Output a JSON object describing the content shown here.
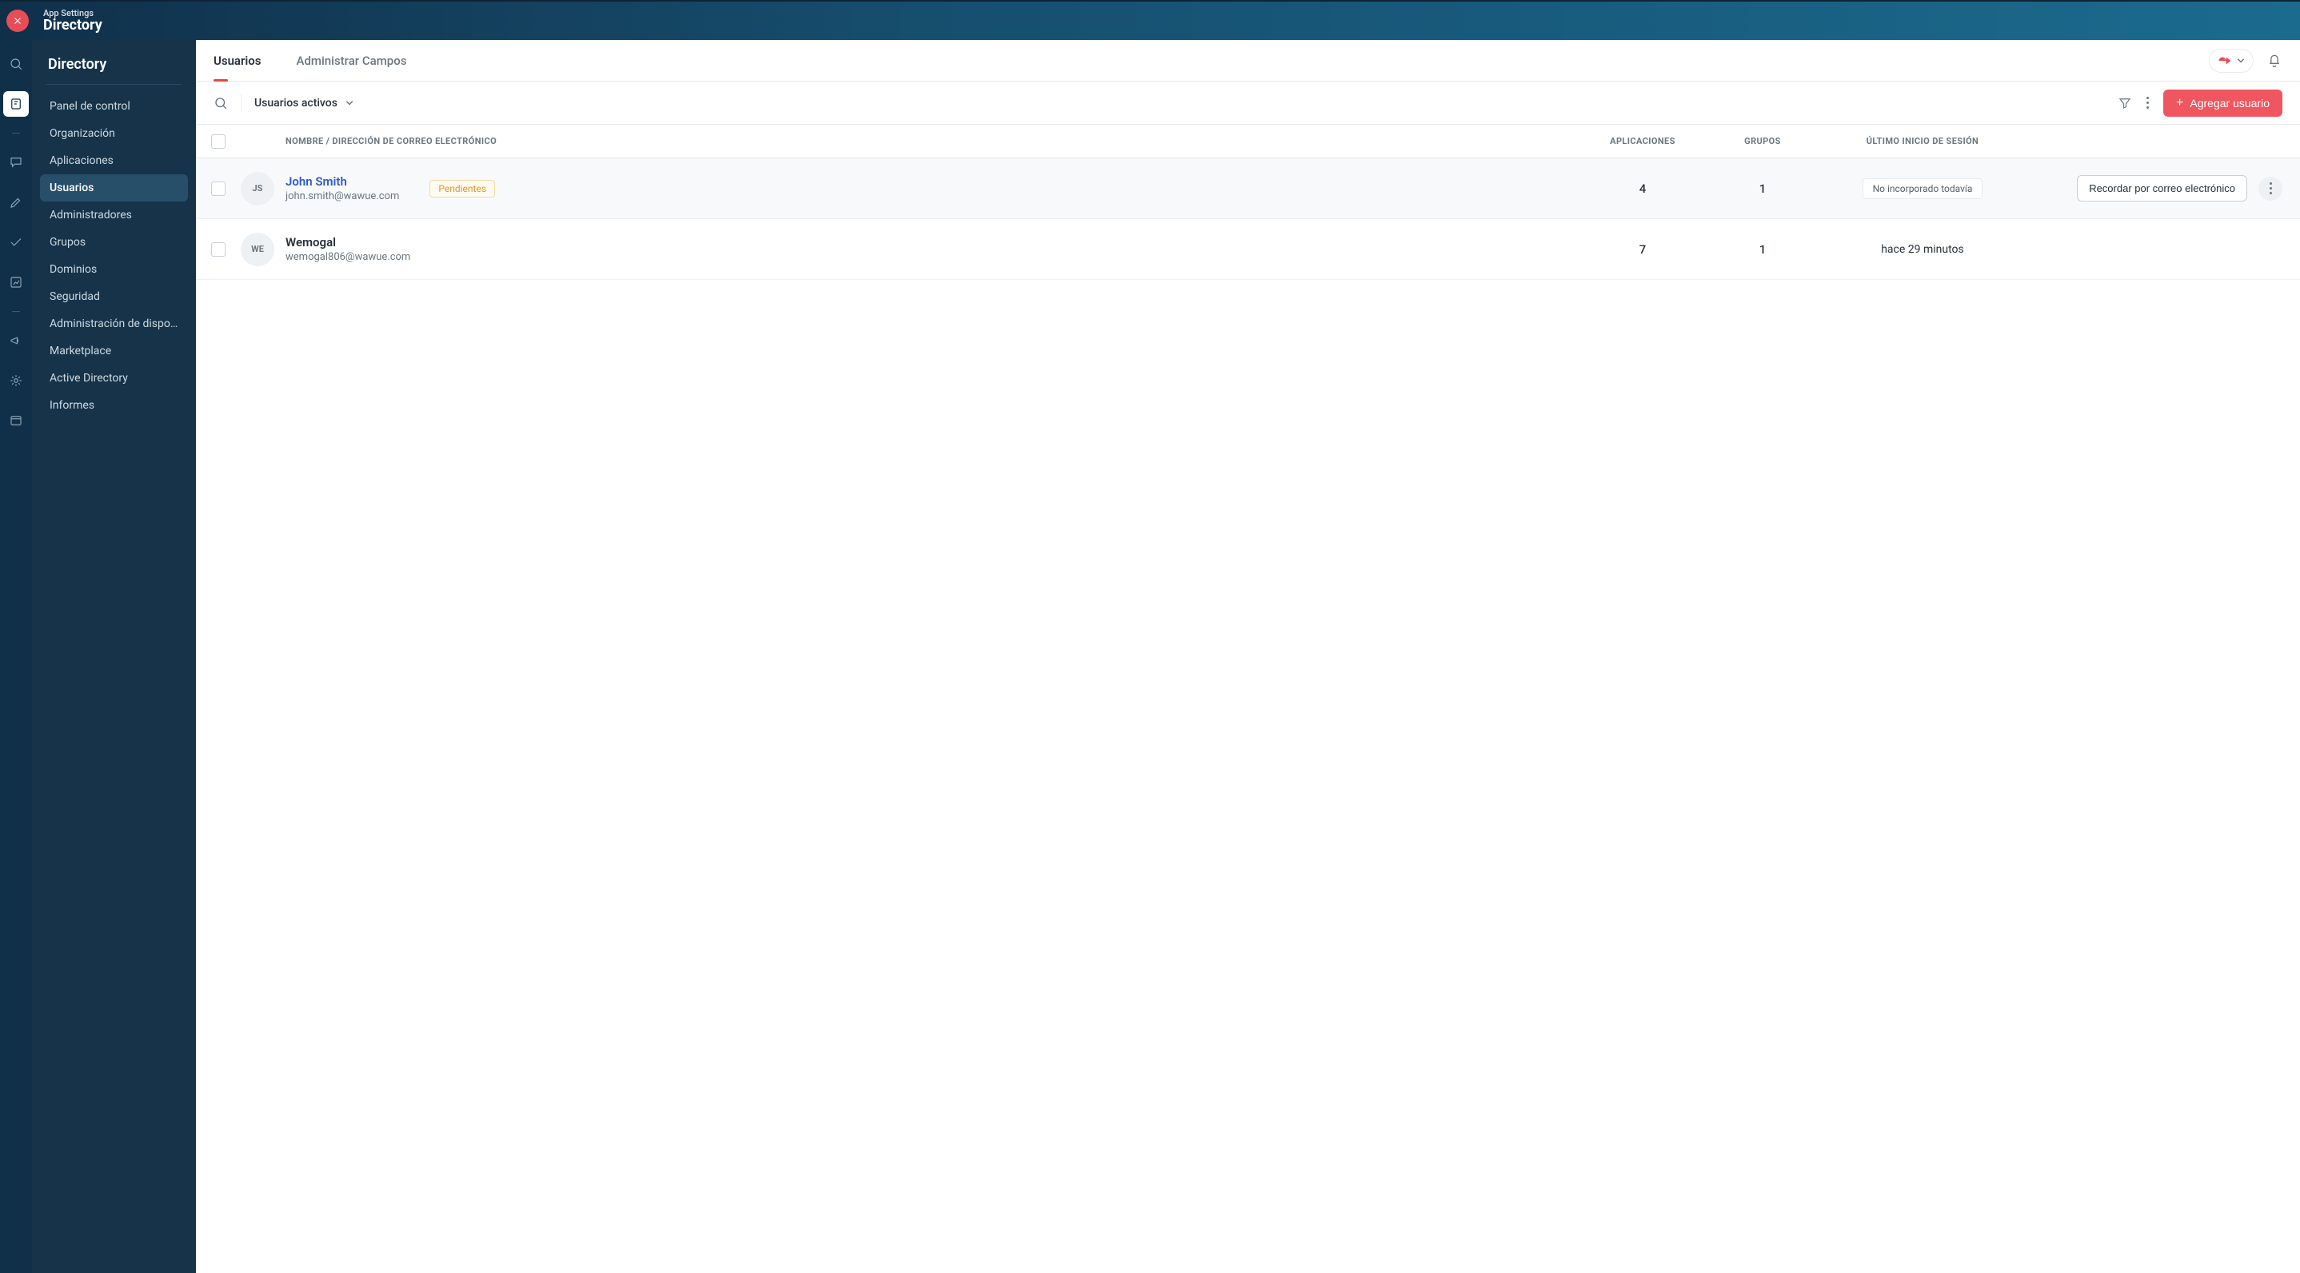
{
  "header": {
    "subtitle": "App Settings",
    "title": "Directory"
  },
  "sidebar": {
    "title": "Directory",
    "items": [
      {
        "label": "Panel de control"
      },
      {
        "label": "Organización"
      },
      {
        "label": "Aplicaciones"
      },
      {
        "label": "Usuarios"
      },
      {
        "label": "Administradores"
      },
      {
        "label": "Grupos"
      },
      {
        "label": "Dominios"
      },
      {
        "label": "Seguridad"
      },
      {
        "label": "Administración de dispositivos"
      },
      {
        "label": "Marketplace"
      },
      {
        "label": "Active Directory"
      },
      {
        "label": "Informes"
      }
    ],
    "active_index": 3
  },
  "tabs": {
    "items": [
      {
        "label": "Usuarios"
      },
      {
        "label": "Administrar Campos"
      }
    ],
    "active_index": 0
  },
  "toolbar": {
    "filter_label": "Usuarios activos",
    "add_button": "Agregar usuario"
  },
  "table": {
    "headers": {
      "name": "NOMBRE / DIRECCIÓN DE CORREO ELECTRÓNICO",
      "apps": "APLICACIONES",
      "groups": "GRUPOS",
      "last_login": "ÚLTIMO INICIO DE SESIÓN"
    },
    "rows": [
      {
        "initials": "JS",
        "name": "John Smith",
        "name_link": true,
        "email": "john.smith@wawue.com",
        "pending_badge": "Pendientes",
        "apps": "4",
        "groups": "1",
        "last_login_status": "No incorporado todavía",
        "last_login_text": "",
        "action_button": "Recordar por correo electrónico",
        "hovered": true
      },
      {
        "initials": "WE",
        "name": "Wemogal",
        "name_link": false,
        "email": "wemogal806@wawue.com",
        "pending_badge": "",
        "apps": "7",
        "groups": "1",
        "last_login_status": "",
        "last_login_text": "hace 29 minutos",
        "action_button": "",
        "hovered": false
      }
    ]
  }
}
